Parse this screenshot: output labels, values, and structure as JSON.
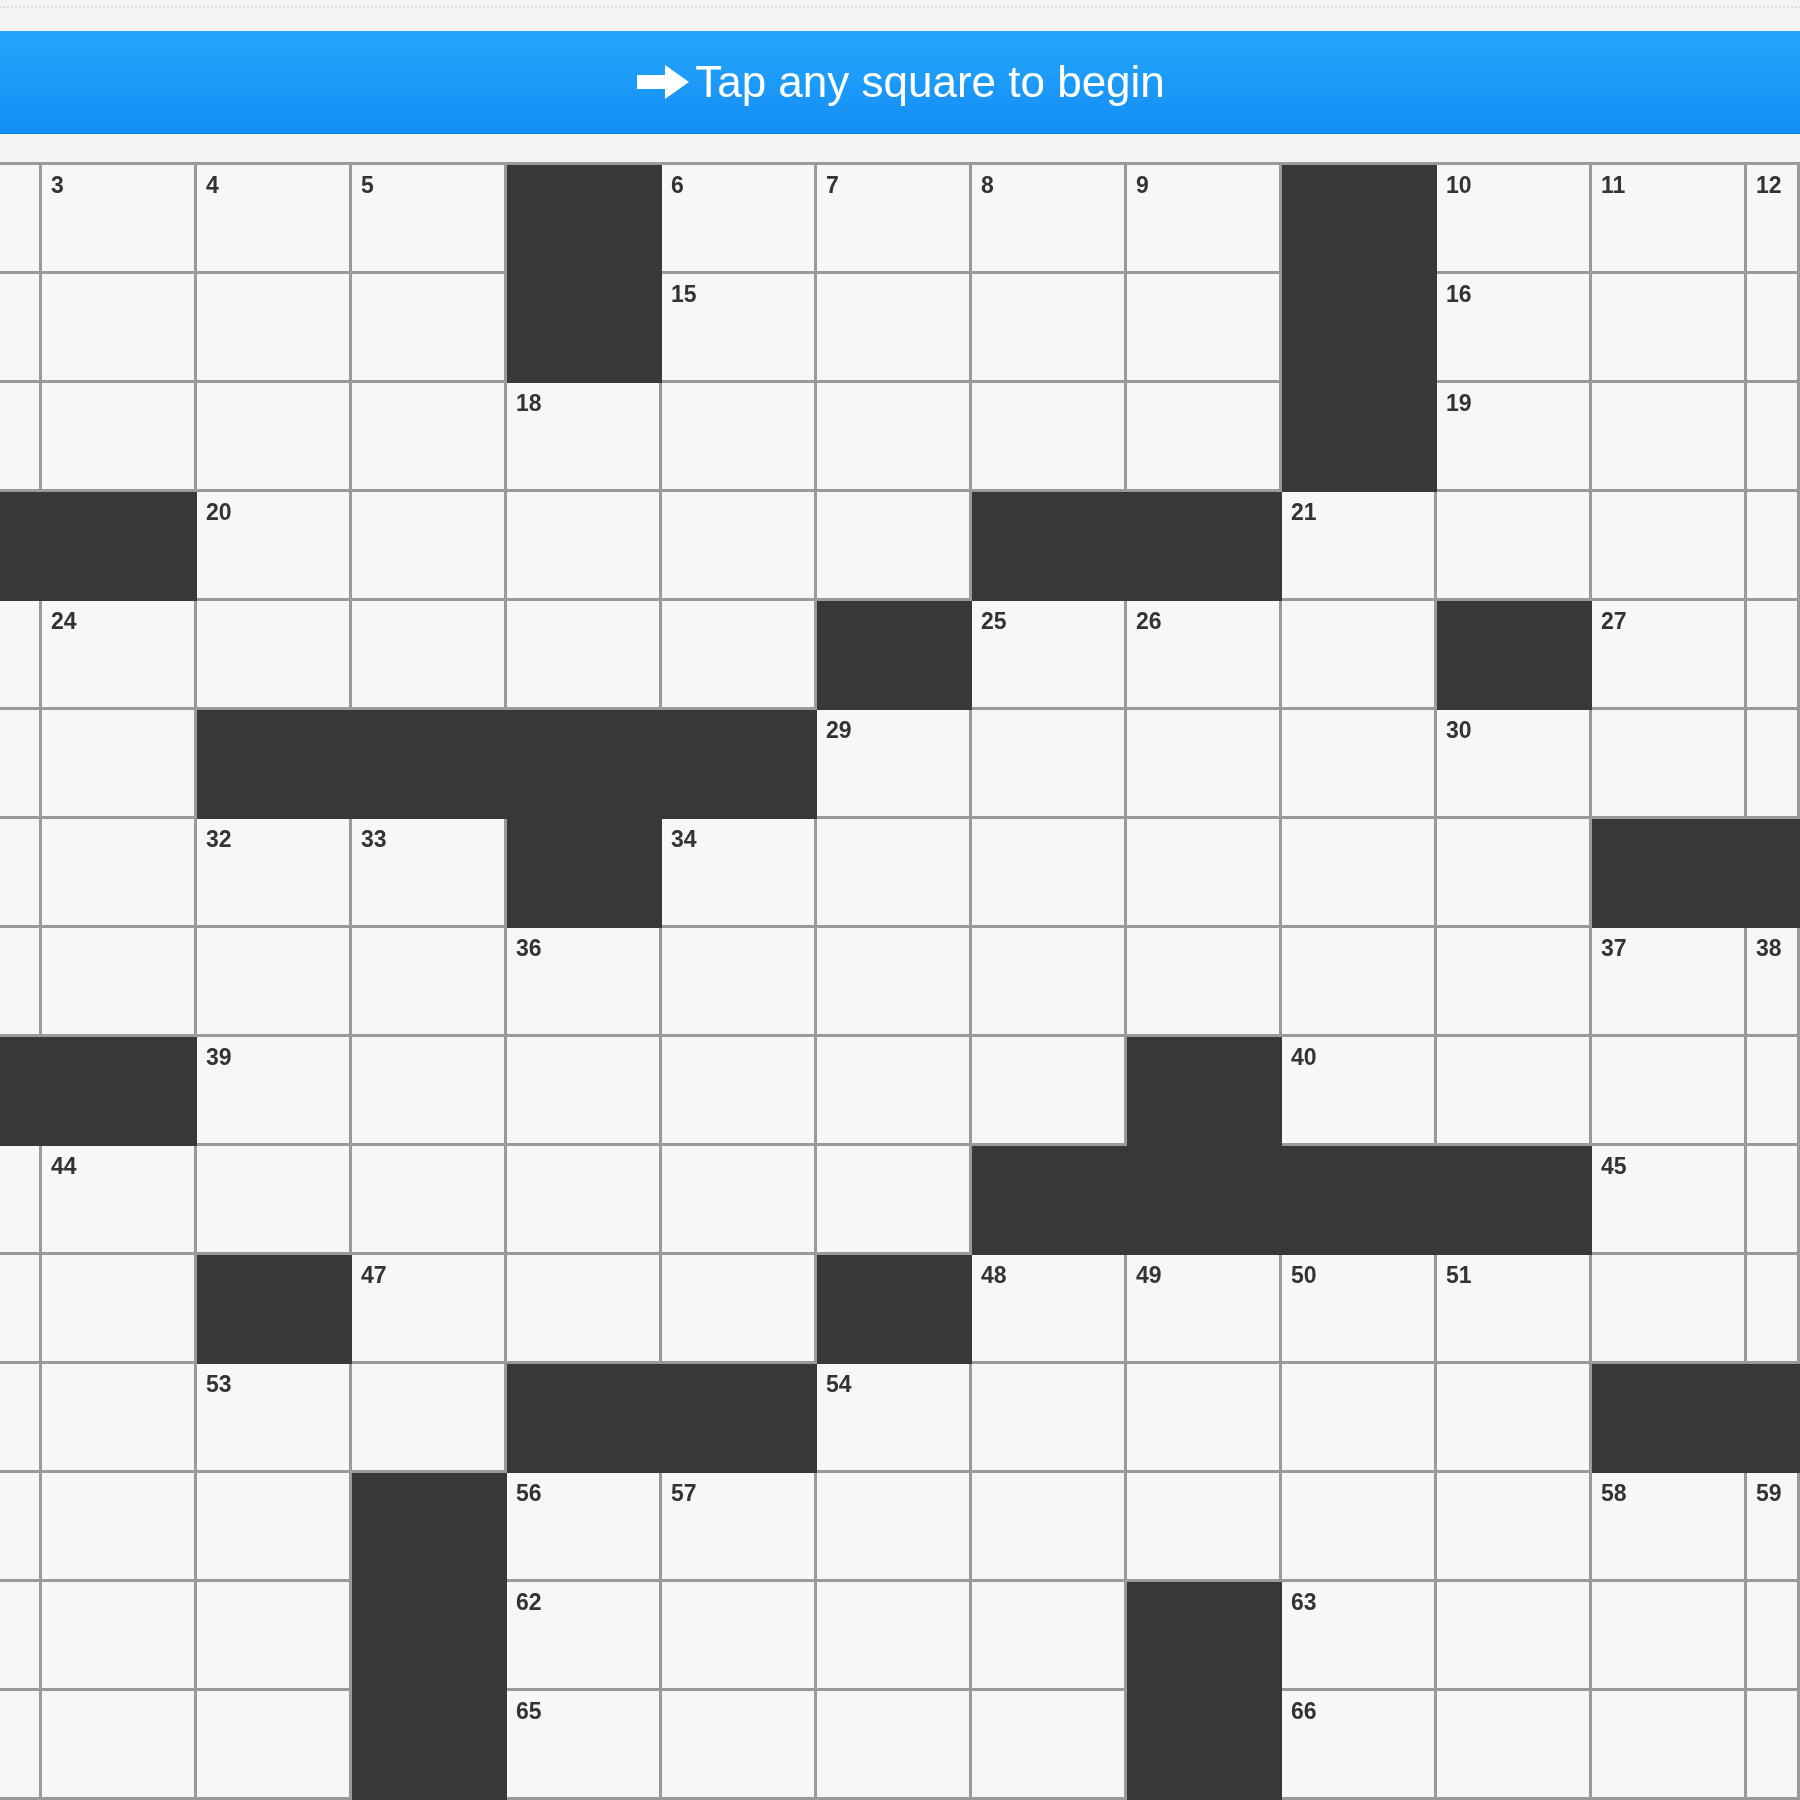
{
  "banner": {
    "text": "Tap any square to begin"
  },
  "grid": {
    "rows": [
      [
        {
          "kind": "white"
        },
        {
          "kind": "white",
          "number": "3"
        },
        {
          "kind": "white",
          "number": "4"
        },
        {
          "kind": "white",
          "number": "5"
        },
        {
          "kind": "black"
        },
        {
          "kind": "white",
          "number": "6"
        },
        {
          "kind": "white",
          "number": "7"
        },
        {
          "kind": "white",
          "number": "8"
        },
        {
          "kind": "white",
          "number": "9"
        },
        {
          "kind": "black"
        },
        {
          "kind": "white",
          "number": "10"
        },
        {
          "kind": "white",
          "number": "11"
        },
        {
          "kind": "white",
          "number": "12"
        }
      ],
      [
        {
          "kind": "white"
        },
        {
          "kind": "white"
        },
        {
          "kind": "white"
        },
        {
          "kind": "white"
        },
        {
          "kind": "black"
        },
        {
          "kind": "white",
          "number": "15"
        },
        {
          "kind": "white"
        },
        {
          "kind": "white"
        },
        {
          "kind": "white"
        },
        {
          "kind": "black"
        },
        {
          "kind": "white",
          "number": "16"
        },
        {
          "kind": "white"
        },
        {
          "kind": "white"
        }
      ],
      [
        {
          "kind": "white"
        },
        {
          "kind": "white"
        },
        {
          "kind": "white"
        },
        {
          "kind": "white"
        },
        {
          "kind": "white",
          "number": "18"
        },
        {
          "kind": "white"
        },
        {
          "kind": "white"
        },
        {
          "kind": "white"
        },
        {
          "kind": "white"
        },
        {
          "kind": "black"
        },
        {
          "kind": "white",
          "number": "19"
        },
        {
          "kind": "white"
        },
        {
          "kind": "white"
        }
      ],
      [
        {
          "kind": "black"
        },
        {
          "kind": "black"
        },
        {
          "kind": "white",
          "number": "20"
        },
        {
          "kind": "white"
        },
        {
          "kind": "white"
        },
        {
          "kind": "white"
        },
        {
          "kind": "white"
        },
        {
          "kind": "black"
        },
        {
          "kind": "black"
        },
        {
          "kind": "white",
          "number": "21"
        },
        {
          "kind": "white"
        },
        {
          "kind": "white"
        },
        {
          "kind": "white"
        }
      ],
      [
        {
          "kind": "white"
        },
        {
          "kind": "white",
          "number": "24"
        },
        {
          "kind": "white"
        },
        {
          "kind": "white"
        },
        {
          "kind": "white"
        },
        {
          "kind": "white"
        },
        {
          "kind": "black"
        },
        {
          "kind": "white",
          "number": "25"
        },
        {
          "kind": "white",
          "number": "26"
        },
        {
          "kind": "white"
        },
        {
          "kind": "black"
        },
        {
          "kind": "white",
          "number": "27"
        },
        {
          "kind": "white"
        }
      ],
      [
        {
          "kind": "white"
        },
        {
          "kind": "white"
        },
        {
          "kind": "black"
        },
        {
          "kind": "black"
        },
        {
          "kind": "black"
        },
        {
          "kind": "black"
        },
        {
          "kind": "white",
          "number": "29"
        },
        {
          "kind": "white"
        },
        {
          "kind": "white"
        },
        {
          "kind": "white"
        },
        {
          "kind": "white",
          "number": "30"
        },
        {
          "kind": "white"
        },
        {
          "kind": "white"
        }
      ],
      [
        {
          "kind": "white"
        },
        {
          "kind": "white"
        },
        {
          "kind": "white",
          "number": "32"
        },
        {
          "kind": "white",
          "number": "33"
        },
        {
          "kind": "black"
        },
        {
          "kind": "white",
          "number": "34"
        },
        {
          "kind": "white"
        },
        {
          "kind": "white"
        },
        {
          "kind": "white"
        },
        {
          "kind": "white"
        },
        {
          "kind": "white"
        },
        {
          "kind": "black"
        },
        {
          "kind": "black"
        }
      ],
      [
        {
          "kind": "white"
        },
        {
          "kind": "white"
        },
        {
          "kind": "white"
        },
        {
          "kind": "white"
        },
        {
          "kind": "white",
          "number": "36"
        },
        {
          "kind": "white"
        },
        {
          "kind": "white"
        },
        {
          "kind": "white"
        },
        {
          "kind": "white"
        },
        {
          "kind": "white"
        },
        {
          "kind": "white"
        },
        {
          "kind": "white",
          "number": "37"
        },
        {
          "kind": "white",
          "number": "38"
        }
      ],
      [
        {
          "kind": "black"
        },
        {
          "kind": "black"
        },
        {
          "kind": "white",
          "number": "39"
        },
        {
          "kind": "white"
        },
        {
          "kind": "white"
        },
        {
          "kind": "white"
        },
        {
          "kind": "white"
        },
        {
          "kind": "white"
        },
        {
          "kind": "black"
        },
        {
          "kind": "white",
          "number": "40"
        },
        {
          "kind": "white"
        },
        {
          "kind": "white"
        },
        {
          "kind": "white"
        }
      ],
      [
        {
          "kind": "white"
        },
        {
          "kind": "white",
          "number": "44"
        },
        {
          "kind": "white"
        },
        {
          "kind": "white"
        },
        {
          "kind": "white"
        },
        {
          "kind": "white"
        },
        {
          "kind": "white"
        },
        {
          "kind": "black"
        },
        {
          "kind": "black"
        },
        {
          "kind": "black"
        },
        {
          "kind": "black"
        },
        {
          "kind": "white",
          "number": "45"
        },
        {
          "kind": "white"
        }
      ],
      [
        {
          "kind": "white"
        },
        {
          "kind": "white"
        },
        {
          "kind": "black"
        },
        {
          "kind": "white",
          "number": "47"
        },
        {
          "kind": "white"
        },
        {
          "kind": "white"
        },
        {
          "kind": "black"
        },
        {
          "kind": "white",
          "number": "48"
        },
        {
          "kind": "white",
          "number": "49"
        },
        {
          "kind": "white",
          "number": "50"
        },
        {
          "kind": "white",
          "number": "51"
        },
        {
          "kind": "white"
        },
        {
          "kind": "white"
        }
      ],
      [
        {
          "kind": "white"
        },
        {
          "kind": "white"
        },
        {
          "kind": "white",
          "number": "53"
        },
        {
          "kind": "white"
        },
        {
          "kind": "black"
        },
        {
          "kind": "black"
        },
        {
          "kind": "white",
          "number": "54"
        },
        {
          "kind": "white"
        },
        {
          "kind": "white"
        },
        {
          "kind": "white"
        },
        {
          "kind": "white"
        },
        {
          "kind": "black"
        },
        {
          "kind": "black"
        }
      ],
      [
        {
          "kind": "white"
        },
        {
          "kind": "white"
        },
        {
          "kind": "white"
        },
        {
          "kind": "black"
        },
        {
          "kind": "white",
          "number": "56"
        },
        {
          "kind": "white",
          "number": "57"
        },
        {
          "kind": "white"
        },
        {
          "kind": "white"
        },
        {
          "kind": "white"
        },
        {
          "kind": "white"
        },
        {
          "kind": "white"
        },
        {
          "kind": "white",
          "number": "58"
        },
        {
          "kind": "white",
          "number": "59"
        }
      ],
      [
        {
          "kind": "white"
        },
        {
          "kind": "white"
        },
        {
          "kind": "white"
        },
        {
          "kind": "black"
        },
        {
          "kind": "white",
          "number": "62"
        },
        {
          "kind": "white"
        },
        {
          "kind": "white"
        },
        {
          "kind": "white"
        },
        {
          "kind": "black"
        },
        {
          "kind": "white",
          "number": "63"
        },
        {
          "kind": "white"
        },
        {
          "kind": "white"
        },
        {
          "kind": "white"
        }
      ],
      [
        {
          "kind": "white"
        },
        {
          "kind": "white"
        },
        {
          "kind": "white"
        },
        {
          "kind": "black"
        },
        {
          "kind": "white",
          "number": "65"
        },
        {
          "kind": "white"
        },
        {
          "kind": "white"
        },
        {
          "kind": "white"
        },
        {
          "kind": "black"
        },
        {
          "kind": "white",
          "number": "66"
        },
        {
          "kind": "white"
        },
        {
          "kind": "white"
        },
        {
          "kind": "white"
        }
      ]
    ]
  }
}
